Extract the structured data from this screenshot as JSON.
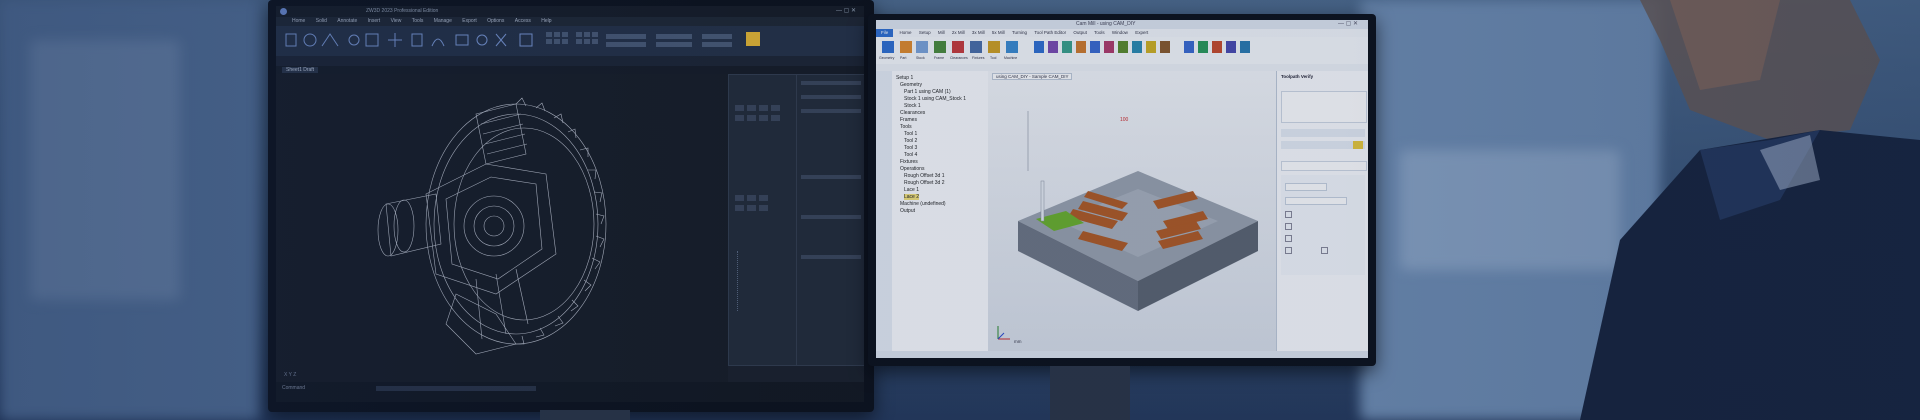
{
  "cad": {
    "title_bar": "ZW3D 2023 Professional Edition",
    "menu": [
      "Home",
      "Solid",
      "Annotate",
      "Insert",
      "View",
      "Tools",
      "Manage",
      "Export",
      "Options",
      "Access",
      "Help"
    ],
    "tab": "Sheet1 Draft",
    "status_left": "Command",
    "accent": "#6f8fd6"
  },
  "cam": {
    "title_bar": "Cam Mill - using CAM_DIY",
    "menu": [
      "Home",
      "Setup",
      "Mill",
      "2x Mill",
      "3x Mill",
      "5x Mill",
      "Turning",
      "Tool Path Editor",
      "Output",
      "Tools",
      "Window",
      "Expert"
    ],
    "ribbon_buttons": [
      "Geometry",
      "Part",
      "Stock",
      "Frame",
      "Clearances",
      "Fixtures",
      "Tool",
      "Machine",
      "Machine Manager",
      "Gold",
      "Surface",
      "Profile",
      "Pocket",
      "Drill",
      "Slot",
      "Chamfer",
      "Corner",
      "Plane",
      "Face",
      "Multi",
      "Rest",
      "Thread",
      "Engrave",
      "Pencil",
      "Flow"
    ],
    "viewport_tab": "using CAM_DIY - Sample CAM_DIY",
    "tree": [
      "Setup 1",
      "Geometry",
      "Part 1 using CAM (1)",
      "Stock 1 using CAM_Stock 1",
      "Stock 1",
      "Clearances",
      "Frames",
      "Tools",
      "Tool 1",
      "Tool 2",
      "Tool 3",
      "Tool 4",
      "Fixtures",
      "Operations",
      "Rough Offset 3d 1",
      "Rough Offset 3d 2",
      "Lace 1",
      "Lace 2",
      "Machine (undefined)",
      "Output"
    ],
    "right_panel_title": "Toolpath Verify",
    "accent": "#2f6fd0",
    "part_color": "#8c94a0",
    "toolpath_color": "#b05a22",
    "highlight_color": "#6bb02a",
    "status_units": "mm"
  }
}
